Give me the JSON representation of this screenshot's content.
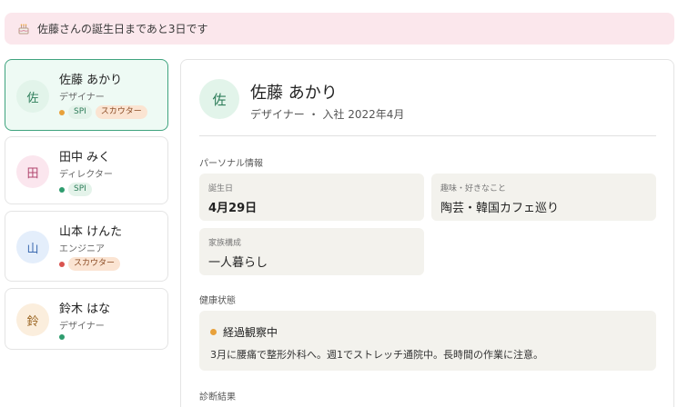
{
  "banner": {
    "text": "佐藤さんの誕生日まであと3日です"
  },
  "members": [
    {
      "initial": "佐",
      "name": "佐藤 あかり",
      "role": "デザイナー",
      "status_color": "#e8a13a",
      "tags": [
        "SPI",
        "スカウター"
      ],
      "avatar_bg": "#e2f4ea",
      "avatar_fg": "#2e7d5a",
      "selected": true
    },
    {
      "initial": "田",
      "name": "田中 みく",
      "role": "ディレクター",
      "status_color": "#2e9c6e",
      "tags": [
        "SPI"
      ],
      "avatar_bg": "#fbe6ee",
      "avatar_fg": "#b0466e",
      "selected": false
    },
    {
      "initial": "山",
      "name": "山本 けんた",
      "role": "エンジニア",
      "status_color": "#d9534f",
      "tags": [
        "スカウター"
      ],
      "avatar_bg": "#e4eefb",
      "avatar_fg": "#3d6bb0",
      "selected": false
    },
    {
      "initial": "鈴",
      "name": "鈴木 はな",
      "role": "デザイナー",
      "status_color": "#2e9c6e",
      "tags": [],
      "avatar_bg": "#fbeedd",
      "avatar_fg": "#9a6420",
      "selected": false
    }
  ],
  "detail": {
    "initial": "佐",
    "name": "佐藤 あかり",
    "subtitle": "デザイナー ・ 入社 2022年4月",
    "personal_label": "パーソナル情報",
    "birthday_label": "誕生日",
    "birthday_value": "4月29日",
    "hobby_label": "趣味・好きなこと",
    "hobby_value": "陶芸・韓国カフェ巡り",
    "family_label": "家族構成",
    "family_value": "一人暮らし",
    "health_label": "健康状態",
    "health_status": "経過観察中",
    "health_status_color": "#e8a13a",
    "health_note": "3月に腰痛で整形外科へ。週1でストレッチ通院中。長時間の作業に注意。",
    "diagnosis_label": "診断結果"
  }
}
